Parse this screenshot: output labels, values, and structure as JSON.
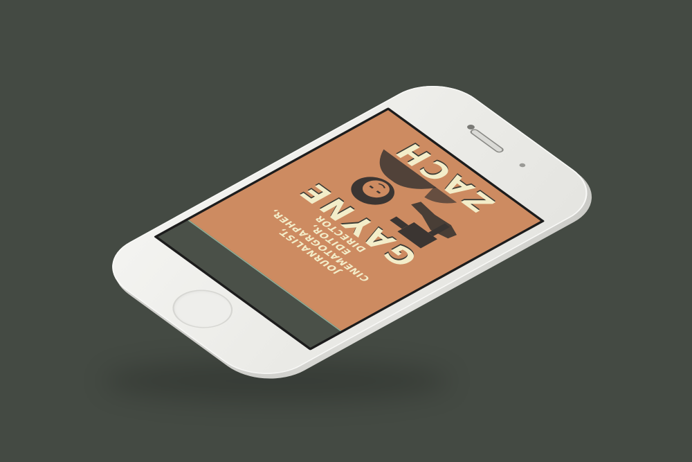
{
  "scene": {
    "background_color": "#444a43",
    "device": "iphone-white"
  },
  "app": {
    "name_first": "ZACH",
    "name_last": "GAYNE",
    "tagline_lines": [
      "JOURNALIST,",
      "CINEMATOGRAPHER, EDITOR,",
      "DIRECTOR"
    ],
    "colors": {
      "poster": "#cd8b61",
      "text": "#f3edc9",
      "sidebar": "#4a5048",
      "accent": "#8fae98"
    },
    "photo_icon": "person-with-camera-illustration"
  }
}
